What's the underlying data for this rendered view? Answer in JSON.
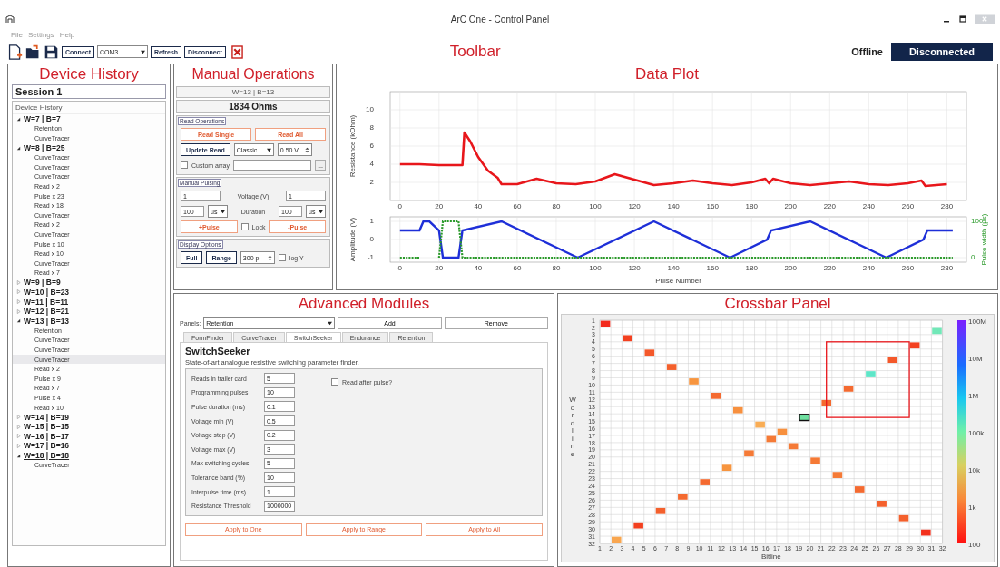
{
  "window": {
    "title": "ArC One - Control Panel"
  },
  "menu": [
    "File",
    "Settings",
    "Help"
  ],
  "toolbar": {
    "annotation": "Toolbar",
    "connect": "Connect",
    "port": "COM3",
    "refresh": "Refresh",
    "disconnect": "Disconnect",
    "mode": "Offline",
    "status": "Disconnected"
  },
  "device_history": {
    "annotation": "Device History",
    "session": "Session 1",
    "header": "Device History",
    "devices": [
      {
        "label": "W=7 | B=7",
        "expanded": true,
        "current": false,
        "children": [
          {
            "label": "Retention",
            "selected": false
          },
          {
            "label": "CurveTracer",
            "selected": false
          }
        ]
      },
      {
        "label": "W=8 | B=25",
        "expanded": true,
        "current": false,
        "children": [
          {
            "label": "CurveTracer",
            "selected": false
          },
          {
            "label": "CurveTracer",
            "selected": false
          },
          {
            "label": "CurveTracer",
            "selected": false
          },
          {
            "label": "Read x 2",
            "selected": false
          },
          {
            "label": "Pulse x 23",
            "selected": false
          },
          {
            "label": "Read x 18",
            "selected": false
          },
          {
            "label": "CurveTracer",
            "selected": false
          },
          {
            "label": "Read x 2",
            "selected": false
          },
          {
            "label": "CurveTracer",
            "selected": false
          },
          {
            "label": "Pulse x 10",
            "selected": false
          },
          {
            "label": "Read x 10",
            "selected": false
          },
          {
            "label": "CurveTracer",
            "selected": false
          },
          {
            "label": "Read x 7",
            "selected": false
          }
        ]
      },
      {
        "label": "W=9 | B=9",
        "expanded": false,
        "current": false
      },
      {
        "label": "W=10 | B=23",
        "expanded": false,
        "current": false
      },
      {
        "label": "W=11 | B=11",
        "expanded": false,
        "current": false
      },
      {
        "label": "W=12 | B=21",
        "expanded": false,
        "current": false
      },
      {
        "label": "W=13 | B=13",
        "expanded": true,
        "current": false,
        "children": [
          {
            "label": "Retention",
            "selected": false
          },
          {
            "label": "CurveTracer",
            "selected": false
          },
          {
            "label": "CurveTracer",
            "selected": false
          },
          {
            "label": "CurveTracer",
            "selected": true
          },
          {
            "label": "Read x 2",
            "selected": false
          },
          {
            "label": "Pulse x 9",
            "selected": false
          },
          {
            "label": "Read x 7",
            "selected": false
          },
          {
            "label": "Pulse x 4",
            "selected": false
          },
          {
            "label": "Read x 10",
            "selected": false
          }
        ]
      },
      {
        "label": "W=14 | B=19",
        "expanded": false,
        "current": false
      },
      {
        "label": "W=15 | B=15",
        "expanded": false,
        "current": false
      },
      {
        "label": "W=16 | B=17",
        "expanded": false,
        "current": false
      },
      {
        "label": "W=17 | B=16",
        "expanded": false,
        "current": false
      },
      {
        "label": "W=18 | B=18",
        "expanded": true,
        "current": true,
        "children": [
          {
            "label": "CurveTracer",
            "selected": false
          }
        ]
      }
    ]
  },
  "manual_operations": {
    "annotation": "Manual Operations",
    "device": "W=13 | B=13",
    "resistance": "1834 Ohms",
    "read_operations": {
      "title": "Read Operations",
      "read_single": "Read Single",
      "read_all": "Read All",
      "update_read": "Update Read",
      "read_mode": "Classic",
      "read_voltage": "0.50 V",
      "custom_array": {
        "label": "Custom array",
        "checked": false
      },
      "browse": "..."
    },
    "manual_pulsing": {
      "title": "Manual Pulsing",
      "positive_voltage": "1",
      "voltage_label": "Voltage (V)",
      "negative_voltage": "1",
      "positive_duration": "100",
      "positive_unit": "us",
      "duration_label": "Duration",
      "negative_duration": "100",
      "negative_unit": "us",
      "plus_pulse": "+Pulse",
      "lock": {
        "label": "Lock",
        "checked": false
      },
      "minus_pulse": "-Pulse"
    },
    "display_options": {
      "title": "Display Options",
      "full": "Full",
      "range": "Range",
      "points": "300 p",
      "log_y": {
        "label": "log Y",
        "checked": false
      }
    }
  },
  "data_plot": {
    "annotation": "Data Plot",
    "resistance_chart": {
      "chart_data": {
        "type": "line",
        "grid": true,
        "ylabel": "Resistance (kOhm)",
        "xlim": [
          -5,
          290
        ],
        "ylim": [
          0,
          12
        ],
        "xticks": [
          0,
          20,
          40,
          60,
          80,
          100,
          120,
          140,
          160,
          180,
          200,
          220,
          240,
          260,
          280
        ],
        "yticks": [
          2,
          4,
          6,
          8,
          10
        ],
        "x": [
          0,
          10,
          20,
          30,
          32,
          33,
          36,
          40,
          45,
          50,
          52,
          60,
          70,
          80,
          90,
          100,
          110,
          120,
          130,
          140,
          150,
          160,
          170,
          180,
          187,
          189,
          191,
          200,
          210,
          220,
          230,
          240,
          250,
          260,
          267,
          269,
          280
        ],
        "series": [
          {
            "color": "#e8161b",
            "values": [
              4.0,
              4.0,
              3.9,
              3.9,
              3.9,
              7.5,
              6.5,
              4.8,
              3.3,
              2.5,
              1.8,
              1.8,
              2.4,
              1.9,
              1.8,
              2.1,
              2.9,
              2.3,
              1.7,
              1.9,
              2.2,
              1.9,
              1.7,
              2.0,
              2.4,
              1.9,
              2.4,
              1.9,
              1.7,
              1.9,
              2.1,
              1.8,
              1.7,
              1.9,
              2.2,
              1.6,
              1.8
            ]
          }
        ]
      }
    },
    "amplitude_chart": {
      "chart_data": {
        "type": "line",
        "grid": true,
        "xlabel": "Pulse Number",
        "ylabel": "Amplitude (V)",
        "y2label": "Pulse width (µs)",
        "xlim": [
          -5,
          290
        ],
        "ylim": [
          -1.25,
          1.25
        ],
        "y2lim": [
          -12.5,
          112.5
        ],
        "xticks": [
          0,
          20,
          40,
          60,
          80,
          100,
          120,
          140,
          160,
          180,
          200,
          220,
          240,
          260,
          280
        ],
        "yticks": [
          -1,
          0,
          1
        ],
        "y2ticks": [
          0,
          100
        ],
        "x": [
          0,
          10,
          12,
          15,
          20,
          22,
          30,
          32,
          52,
          91,
          130,
          169,
          188,
          190,
          210,
          249,
          268,
          270,
          283
        ],
        "series": [
          {
            "color": "#1e2fd8",
            "values": [
              0.5,
              0.5,
              1,
              1,
              0.5,
              -1,
              -1,
              0.5,
              1,
              -1,
              1,
              -1,
              0,
              0.5,
              1,
              -1,
              0,
              0.5,
              0.5
            ]
          },
          {
            "color": "#2a9a2a",
            "axis": "y2",
            "line_style": "dotted",
            "values": [
              0,
              0,
              null,
              null,
              0,
              100,
              100,
              0,
              0,
              0,
              0,
              0,
              0,
              0,
              0,
              0,
              0,
              0,
              0
            ]
          }
        ]
      }
    }
  },
  "advanced_modules": {
    "annotation": "Advanced Modules",
    "panels_label": "Panels:",
    "panel_select": "Retention",
    "add": "Add",
    "remove": "Remove",
    "tabs": [
      {
        "label": "FormFinder",
        "selected": false
      },
      {
        "label": "CurveTracer",
        "selected": false
      },
      {
        "label": "SwitchSeeker",
        "selected": true
      },
      {
        "label": "Endurance",
        "selected": false
      },
      {
        "label": "Retention",
        "selected": false
      }
    ],
    "heading": "SwitchSeeker",
    "description": "State-of-art analogue resistive switching parameter finder.",
    "parameters": [
      {
        "label": "Reads in trailer card",
        "value": "5"
      },
      {
        "label": "Programming pulses",
        "value": "10"
      },
      {
        "label": "Pulse duration (ms)",
        "value": "0.1"
      },
      {
        "label": "Voltage min (V)",
        "value": "0.5"
      },
      {
        "label": "Voltage step (V)",
        "value": "0.2"
      },
      {
        "label": "Voltage max (V)",
        "value": "3"
      },
      {
        "label": "Max switching cycles",
        "value": "5"
      },
      {
        "label": "Tolerance band (%)",
        "value": "10"
      },
      {
        "label": "Interpulse time (ms)",
        "value": "1"
      },
      {
        "label": "Resistance Threshold",
        "value": "1000000"
      }
    ],
    "read_after_pulse": {
      "label": "Read after pulse?",
      "checked": false
    },
    "apply_buttons": [
      "Apply to One",
      "Apply to Range",
      "Apply to All"
    ]
  },
  "crossbar": {
    "annotation": "Crossbar Panel",
    "chart_data": {
      "type": "scatter",
      "grid": true,
      "xlabel": "Bitline",
      "ylabel": "Wordline",
      "xlim": [
        1,
        32
      ],
      "ylim": [
        32,
        1
      ],
      "xticks": [
        1,
        2,
        3,
        4,
        5,
        6,
        7,
        8,
        9,
        10,
        11,
        12,
        13,
        14,
        15,
        16,
        17,
        18,
        19,
        20,
        21,
        22,
        23,
        24,
        25,
        26,
        27,
        28,
        29,
        30,
        31,
        32
      ],
      "yticks": [
        1,
        2,
        3,
        4,
        5,
        6,
        7,
        8,
        9,
        10,
        11,
        12,
        13,
        14,
        15,
        16,
        17,
        18,
        19,
        20,
        21,
        22,
        23,
        24,
        25,
        26,
        27,
        28,
        29,
        30,
        31,
        32
      ],
      "x": [
        1.5,
        31.5,
        3.5,
        29.5,
        5.5,
        27.5,
        7.5,
        25.5,
        9.5,
        23.5,
        11.5,
        21.5,
        13.5,
        19.5,
        15.5,
        17.5,
        16.5,
        18.5,
        14.5,
        20.5,
        12.5,
        22.5,
        10.5,
        24.5,
        8.5,
        26.5,
        6.5,
        28.5,
        4.5,
        30.5,
        2.5
      ],
      "series": [
        {
          "values": [
            1.5,
            2.5,
            3.5,
            4.5,
            5.5,
            6.5,
            7.5,
            8.5,
            9.5,
            10.5,
            11.5,
            12.5,
            13.5,
            14.5,
            15.5,
            16.5,
            17.5,
            18.5,
            19.5,
            20.5,
            21.5,
            22.5,
            23.5,
            24.5,
            25.5,
            26.5,
            27.5,
            28.5,
            29.5,
            30.5,
            31.5
          ]
        }
      ]
    },
    "cells": [
      {
        "color": "#f32a1c",
        "selected": false
      },
      {
        "color": "#72e8b8",
        "selected": false
      },
      {
        "color": "#f3401f",
        "selected": false
      },
      {
        "color": "#f3401f",
        "selected": false
      },
      {
        "color": "#f4582a",
        "selected": false
      },
      {
        "color": "#f4582a",
        "selected": false
      },
      {
        "color": "#f4602c",
        "selected": false
      },
      {
        "color": "#5ee6c8",
        "selected": false
      },
      {
        "color": "#f7953f",
        "selected": false
      },
      {
        "color": "#f46a30",
        "selected": false
      },
      {
        "color": "#f46a30",
        "selected": false
      },
      {
        "color": "#f46a30",
        "selected": false
      },
      {
        "color": "#f7903e",
        "selected": false
      },
      {
        "color": "#6fe0a0",
        "selected": true
      },
      {
        "color": "#f9ad55",
        "selected": false
      },
      {
        "color": "#f7903e",
        "selected": false
      },
      {
        "color": "#f57a36",
        "selected": false
      },
      {
        "color": "#f57a36",
        "selected": false
      },
      {
        "color": "#f57a36",
        "selected": false
      },
      {
        "color": "#f57a36",
        "selected": false
      },
      {
        "color": "#f7953f",
        "selected": false
      },
      {
        "color": "#f57a36",
        "selected": false
      },
      {
        "color": "#f46a30",
        "selected": false
      },
      {
        "color": "#f46a30",
        "selected": false
      },
      {
        "color": "#f46a30",
        "selected": false
      },
      {
        "color": "#f4602c",
        "selected": false
      },
      {
        "color": "#f4602c",
        "selected": false
      },
      {
        "color": "#f4602c",
        "selected": false
      },
      {
        "color": "#f3401f",
        "selected": false
      },
      {
        "color": "#f3301c",
        "selected": false
      },
      {
        "color": "#f9a64f",
        "selected": false
      }
    ],
    "colorbar": {
      "labels": [
        "100M",
        "10M",
        "1M",
        "100k",
        "10k",
        "1k",
        "100"
      ]
    }
  }
}
